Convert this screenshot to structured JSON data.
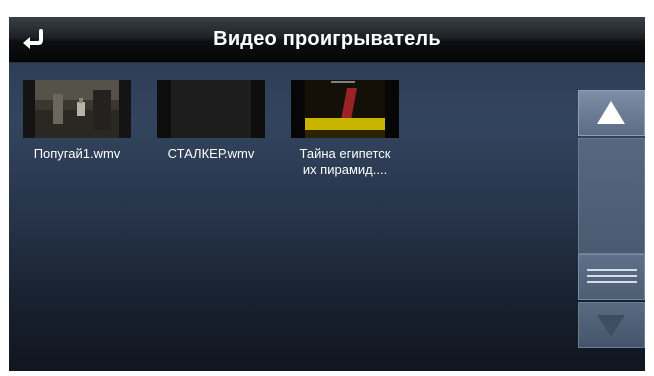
{
  "header": {
    "title": "Видео проигрыватель",
    "back_icon": "return-arrow-icon"
  },
  "files": [
    {
      "name": "Попугай1.wmv",
      "lines": [
        "Попугай1.wmv"
      ]
    },
    {
      "name": "СТАЛКЕР.wmv",
      "lines": [
        "СТАЛКЕР.wmv"
      ]
    },
    {
      "name": "Тайна египетских пирамид....",
      "lines": [
        "Тайна египетск",
        "их пирамид...."
      ]
    }
  ],
  "scrollbar": {
    "up_icon": "triangle-up-icon",
    "grip_icon": "grip-lines-icon",
    "down_icon": "triangle-down-icon"
  },
  "colors": {
    "background_top": "#33445e",
    "background_bottom": "#10161f",
    "title_text": "#ffffff",
    "scroll_button": "#5b6c85"
  }
}
